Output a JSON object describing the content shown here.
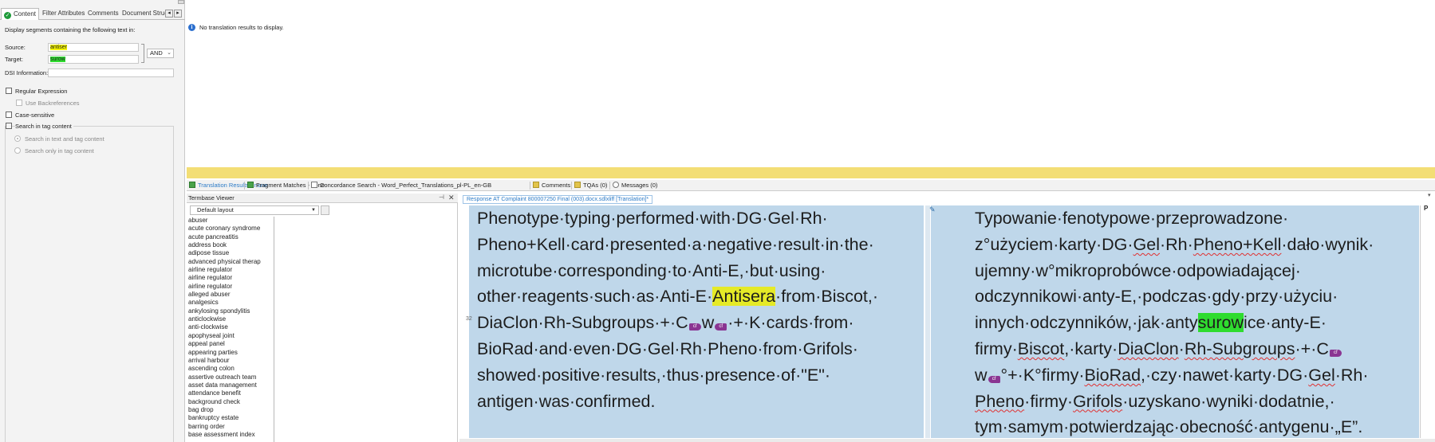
{
  "filter_panel": {
    "tabs": [
      "Content",
      "Filter Attributes",
      "Comments",
      "Document Struct"
    ],
    "active_tab": "Content",
    "description": "Display segments containing the following text in:",
    "source_label": "Source:",
    "source_value": "antiser",
    "target_label": "Target:",
    "target_value": "surow",
    "operator": "AND",
    "dsi_label": "DSI Information:",
    "dsi_value": "",
    "regex_label": "Regular Expression",
    "backrefs_label": "Use Backreferences",
    "case_label": "Case-sensitive",
    "tag_content_label": "Search in tag content",
    "radio_text_and_tag": "Search in text and tag content",
    "radio_only_tag": "Search only in tag content"
  },
  "results": {
    "info_text": "No translation results to display."
  },
  "tool_tabs": {
    "translation_results": "Translation Results - none",
    "fragment_matches": "Fragment Matches - none",
    "concordance": "Concordance Search - Word_Perfect_Translations_pl-PL_en-GB",
    "comments": "Comments",
    "tqas": "TQAs (0)",
    "messages": "Messages (0)"
  },
  "termbase": {
    "title": "Termbase Viewer",
    "layout": "Default layout",
    "terms": [
      "abuser",
      "acute coronary syndrome",
      "acute pancreatitis",
      "address book",
      "adipose tissue",
      "advanced physical therap",
      "airline regulator",
      "airline regulator",
      "airline regulator",
      "alleged abuser",
      "analgesics",
      "ankylosing spondylitis",
      "anticlockwise",
      "anti-clockwise",
      "apophyseal joint",
      "appeal panel",
      "appearing parties",
      "arrival harbour",
      "ascending colon",
      "assertive outreach team",
      "asset data management",
      "attendance benefit",
      "background check",
      "bag drop",
      "bankruptcy estate",
      "barring order",
      "base assessment index"
    ]
  },
  "editor": {
    "document_tab": "Response AT Complaint 800007250 Final (003).docx.sdlxliff [Translation]*",
    "segment_number": "32",
    "status": "P",
    "source_lines": {
      "l1": "Phenotype·typing·performed·with·DG·Gel·Rh·",
      "l2": "Pheno+Kell·card·presented·a·negative·result·in·the·",
      "l3": "microtube·corresponding·to·Anti-E,·but·using·",
      "l4a": "other·reagents·such·as·Anti-E·",
      "l4hl": "Antisera",
      "l4b": "·from·Biscot,·",
      "l5a": "DiaClon·Rh-Subgroups·+·C",
      "l5b": "w",
      "l5c": "·+·K·cards·from·",
      "l6": "BioRad·and·even·DG·Gel·Rh·Pheno·from·Grifols·",
      "l7": "showed·positive·results,·thus·presence·of·\"E\"·",
      "l8": "antigen·was·confirmed."
    },
    "target_lines": {
      "l1": "Typowanie·fenotypowe·przeprowadzone·",
      "l2a": "z°użyciem·karty·DG·",
      "l2b": "Gel",
      "l2c": "·Rh·",
      "l2d": "Pheno+Kell",
      "l2e": "·dało·wynik·",
      "l3": "ujemny·w°mikroprobówce·odpowiadającej·",
      "l4": "odczynnikowi·anty-E,·podczas·gdy·przy·użyciu·",
      "l5a": "innych·odczynników,·jak·anty",
      "l5hl": "surow",
      "l5b": "ice·anty-E·",
      "l6a": "firmy·",
      "l6b": "Biscot",
      "l6c": ",·karty·",
      "l6d": "DiaClon",
      "l6e": "·",
      "l6f": "Rh-Subgroups",
      "l6g": "·+·C",
      "l7a": "w",
      "l7b": "°+·K°firmy·",
      "l7c": "BioRad",
      "l7d": ",·czy·nawet·karty·DG·",
      "l7e": "Gel",
      "l7f": "·Rh·",
      "l8a": "Pheno",
      "l8b": "·firmy·",
      "l8c": "Grifols",
      "l8d": "·uzyskano·wyniki·dodatnie,·",
      "l9": "tym·samym·potwierdzając·obecność·antygenu·„E”."
    },
    "tag_label": "cf"
  },
  "colors": {
    "segment_bg": "#bfd7ea",
    "source_highlight": "#e5ea27",
    "target_highlight": "#2fdc2f",
    "tag": "#8a3592",
    "banner": "#f3de75"
  }
}
